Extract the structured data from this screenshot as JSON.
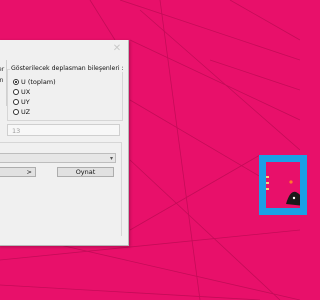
{
  "dialog": {
    "left_labels": [
      "er",
      "ın"
    ],
    "group_title": "Gösterilecek deplasman bileşenleri :",
    "options": [
      {
        "label": "U (toplam)",
        "checked": true
      },
      {
        "label": "UX",
        "checked": false
      },
      {
        "label": "UY",
        "checked": false
      },
      {
        "label": "UZ",
        "checked": false
      }
    ],
    "field_value": "13",
    "select_value": "",
    "prev_button_label": ">",
    "play_button_label": "Oynat"
  },
  "colors": {
    "background": "#e8106a",
    "frame": "#1aa0e6"
  }
}
